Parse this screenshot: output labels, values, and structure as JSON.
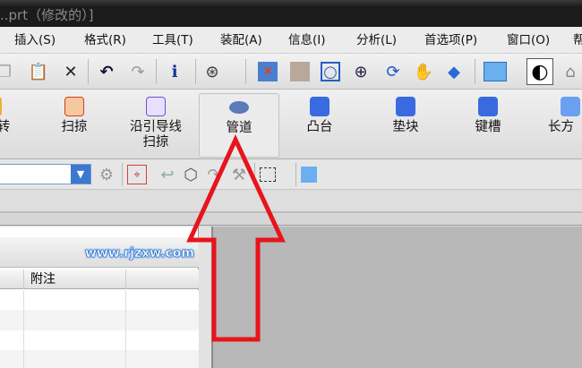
{
  "title": "..prt（修改的）]",
  "menu": [
    "插入(S)",
    "格式(R)",
    "工具(T)",
    "装配(A)",
    "信息(I)",
    "分析(L)",
    "首选项(P)",
    "窗口(O)",
    "帮"
  ],
  "ribbon": {
    "items": [
      {
        "label": "转"
      },
      {
        "label": "扫掠"
      },
      {
        "label": "沿引导线",
        "label2": "扫掠"
      },
      {
        "label": "管道"
      },
      {
        "label": "凸台"
      },
      {
        "label": "垫块"
      },
      {
        "label": "键槽"
      },
      {
        "label": "长方"
      }
    ],
    "selected": "管道"
  },
  "panel": {
    "watermark": "www.rjzxw.com",
    "columns": [
      "",
      "附注",
      ""
    ]
  },
  "annotation_color": "#e8141c"
}
